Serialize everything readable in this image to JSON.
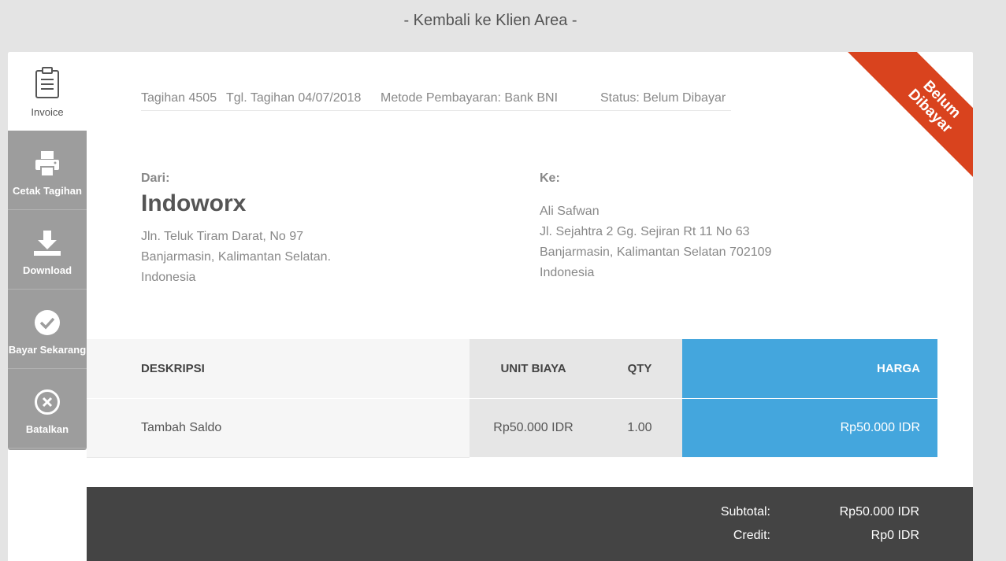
{
  "back_link": "- Kembali ke Klien Area -",
  "sidebar": {
    "items": [
      {
        "label": "Invoice",
        "icon": "clipboard-icon"
      },
      {
        "label": "Cetak Tagihan",
        "icon": "printer-icon"
      },
      {
        "label": "Download",
        "icon": "download-icon"
      },
      {
        "label": "Bayar Sekarang",
        "icon": "check-circle-icon"
      },
      {
        "label": "Batalkan",
        "icon": "close-circle-icon"
      }
    ]
  },
  "ribbon": {
    "line1": "Belum",
    "line2": "Dibayar",
    "color": "#d9431e"
  },
  "meta": {
    "invoice": "Tagihan 4505",
    "date": "Tgl. Tagihan 04/07/2018",
    "method": "Metode Pembayaran: Bank BNI",
    "status": "Status: Belum Dibayar"
  },
  "from": {
    "label": "Dari:",
    "name": "Indoworx",
    "lines": [
      "Jln. Teluk Tiram Darat, No 97",
      "Banjarmasin, Kalimantan Selatan.",
      "Indonesia"
    ]
  },
  "to": {
    "label": "Ke:",
    "lines": [
      "Ali Safwan",
      "Jl. Sejahtra 2 Gg. Sejiran Rt 11 No 63",
      "Banjarmasin, Kalimantan Selatan 702109",
      "Indonesia"
    ]
  },
  "table": {
    "headers": {
      "desc": "DESKRIPSI",
      "unit": "UNIT BIAYA",
      "qty": "QTY",
      "price": "HARGA"
    },
    "rows": [
      {
        "desc": "Tambah Saldo",
        "unit": "Rp50.000 IDR",
        "qty": "1.00",
        "price": "Rp50.000 IDR"
      }
    ],
    "accent": "#44a6dd"
  },
  "totals": {
    "subtotal_label": "Subtotal:",
    "subtotal_value": "Rp50.000 IDR",
    "credit_label": "Credit:",
    "credit_value": "Rp0 IDR"
  }
}
